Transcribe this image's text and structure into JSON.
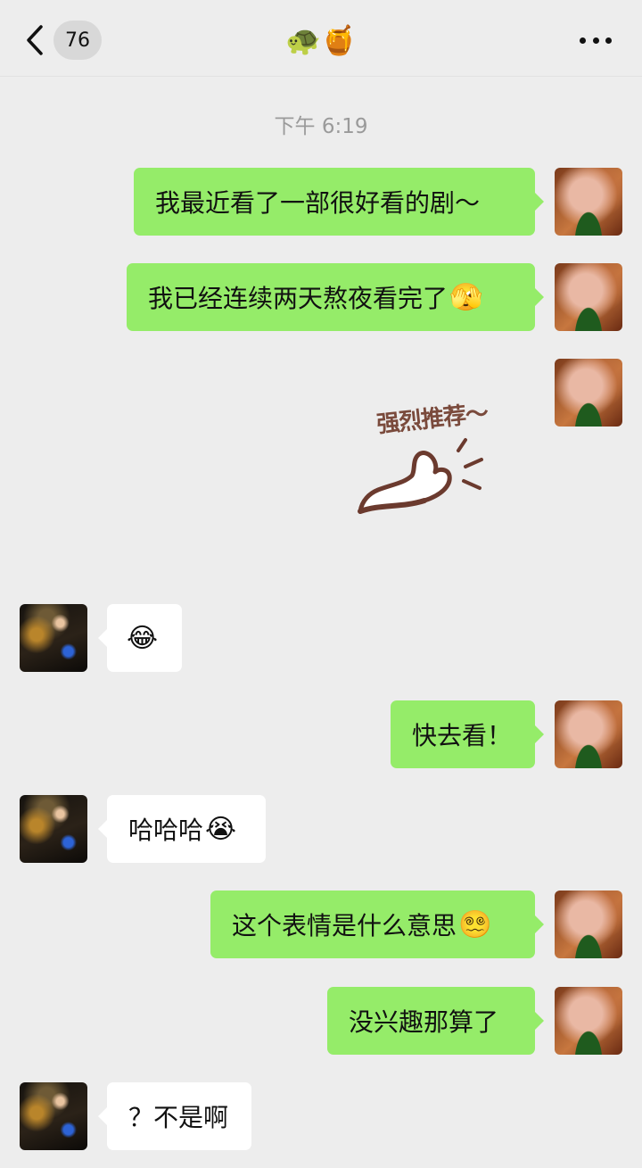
{
  "header": {
    "unread_count": "76",
    "title": "🐢🍯"
  },
  "timestamp": "下午 6:19",
  "messages": [
    {
      "from": "me",
      "text": "我最近看了一部很好看的剧～"
    },
    {
      "from": "me",
      "text": "我已经连续两天熬夜看完了",
      "emoji": "🫣"
    },
    {
      "from": "me",
      "sticker_text": "强烈推荐～"
    },
    {
      "from": "friend",
      "emoji": "😂"
    },
    {
      "from": "me",
      "text": "快去看！"
    },
    {
      "from": "friend",
      "text": "哈哈哈",
      "emoji": "😭"
    },
    {
      "from": "me",
      "text": "这个表情是什么意思",
      "emoji": "😵‍💫"
    },
    {
      "from": "me",
      "text": "没兴趣那算了"
    },
    {
      "from": "friend",
      "text": "？不是啊"
    }
  ],
  "colors": {
    "my_bubble": "#95ec69",
    "friend_bubble": "#ffffff",
    "background": "#ededed"
  }
}
